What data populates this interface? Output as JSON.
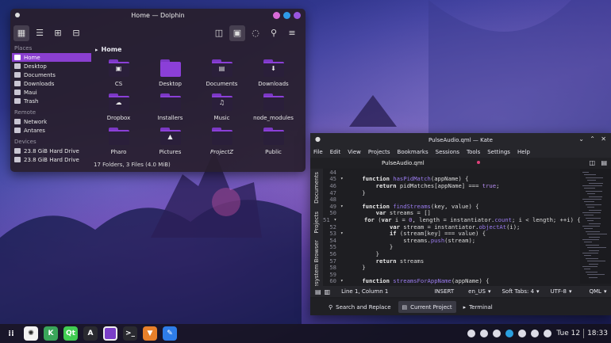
{
  "dolphin": {
    "title": "Home — Dolphin",
    "breadcrumb": "Home",
    "places_heading": "Places",
    "places": [
      "Home",
      "Desktop",
      "Documents",
      "Downloads",
      "Maui",
      "Trash"
    ],
    "remote_heading": "Remote",
    "remote": [
      "Network",
      "Antares"
    ],
    "devices_heading": "Devices",
    "devices": [
      "23.8 GiB Hard Drive",
      "23.8 GiB Hard Drive"
    ],
    "files": [
      {
        "name": "CS",
        "glyph": "▣"
      },
      {
        "name": "Desktop",
        "glyph": ""
      },
      {
        "name": "Documents",
        "glyph": "▤"
      },
      {
        "name": "Downloads",
        "glyph": "⬇"
      },
      {
        "name": "Dropbox",
        "glyph": "☁"
      },
      {
        "name": "Installers",
        "glyph": ""
      },
      {
        "name": "Music",
        "glyph": "♫"
      },
      {
        "name": "node_modules",
        "glyph": ""
      },
      {
        "name": "Pharo",
        "glyph": ""
      },
      {
        "name": "Pictures",
        "glyph": "▲"
      },
      {
        "name": "ProjectZ",
        "glyph": ""
      },
      {
        "name": "Public",
        "glyph": ""
      }
    ],
    "status": "17 Folders, 3 Files (4.0 MiB)",
    "colors": {
      "accent": "#8a3fd0",
      "win_pink": "#d86bd8",
      "win_blue": "#2e9be8",
      "win_purple": "#9a55e0"
    }
  },
  "kate": {
    "title": "PulseAudio.qml — Kate",
    "menu": [
      "File",
      "Edit",
      "View",
      "Projects",
      "Bookmarks",
      "Sessions",
      "Tools",
      "Settings",
      "Help"
    ],
    "tab": "PulseAudio.qml",
    "side_panels": [
      "Documents",
      "Projects",
      "Filesystem Browser"
    ],
    "code": [
      {
        "n": "44",
        "f": "",
        "t": ""
      },
      {
        "n": "45",
        "f": "▾",
        "t": "    function hasPidMatch(appName) {"
      },
      {
        "n": "46",
        "f": "",
        "t": "        return pidMatches[appName] === true;"
      },
      {
        "n": "47",
        "f": "",
        "t": "    }"
      },
      {
        "n": "48",
        "f": "",
        "t": ""
      },
      {
        "n": "49",
        "f": "▾",
        "t": "    function findStreams(key, value) {"
      },
      {
        "n": "50",
        "f": "",
        "t": "        var streams = []"
      },
      {
        "n": "51",
        "f": "▾",
        "t": "        for (var i = 0, length = instantiator.count; i < length; ++i) {"
      },
      {
        "n": "52",
        "f": "",
        "t": "            var stream = instantiator.objectAt(i);"
      },
      {
        "n": "53",
        "f": "▾",
        "t": "            if (stream[key] === value) {"
      },
      {
        "n": "54",
        "f": "",
        "t": "                streams.push(stream);"
      },
      {
        "n": "55",
        "f": "",
        "t": "            }"
      },
      {
        "n": "56",
        "f": "",
        "t": "        }"
      },
      {
        "n": "57",
        "f": "",
        "t": "        return streams"
      },
      {
        "n": "58",
        "f": "",
        "t": "    }"
      },
      {
        "n": "59",
        "f": "",
        "t": ""
      },
      {
        "n": "60",
        "f": "▾",
        "t": "    function streamsForAppName(appName) {"
      }
    ],
    "status": {
      "position": "Line 1, Column 1",
      "mode": "INSERT",
      "lang": "en_US",
      "tabs": "Soft Tabs: 4",
      "encoding": "UTF-8",
      "syntax": "QML"
    },
    "bottom": [
      "Search and Replace",
      "Current Project",
      "Terminal"
    ]
  },
  "taskbar": {
    "apps": [
      {
        "name": "Octopi",
        "glyph": "✺",
        "color": "#f2f2f2"
      },
      {
        "name": "KDevelop",
        "glyph": "K",
        "color": "#3aa65a"
      },
      {
        "name": "QtCreator",
        "glyph": "Qt",
        "color": "#41cd52"
      },
      {
        "name": "Typography",
        "glyph": "A",
        "color": "#2a2a30"
      },
      {
        "name": "Window",
        "glyph": "",
        "color": "#7a3fc8"
      },
      {
        "name": "Terminal",
        "glyph": ">_",
        "color": "#2a2a30"
      },
      {
        "name": "Archive",
        "glyph": "▼",
        "color": "#e8802a"
      },
      {
        "name": "Editor",
        "glyph": "✎",
        "color": "#2e7de8"
      }
    ],
    "clock_day": "Tue 12",
    "clock_time": "18:33"
  }
}
